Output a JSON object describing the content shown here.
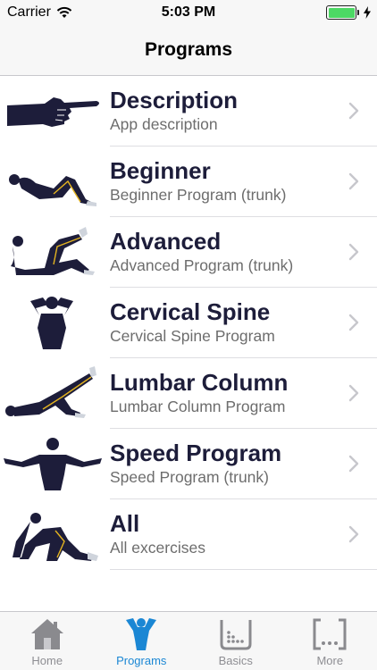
{
  "status_bar": {
    "carrier": "Carrier",
    "time": "5:03 PM",
    "battery_level": 1.0,
    "battery_color": "#4cd964"
  },
  "nav": {
    "title": "Programs"
  },
  "programs": [
    {
      "title": "Description",
      "subtitle": "App description",
      "icon": "pointing-hand-icon"
    },
    {
      "title": "Beginner",
      "subtitle": "Beginner Program (trunk)",
      "icon": "lying-figure-icon"
    },
    {
      "title": "Advanced",
      "subtitle": "Advanced Program (trunk)",
      "icon": "crunch-figure-icon"
    },
    {
      "title": "Cervical Spine",
      "subtitle": "Cervical Spine Program",
      "icon": "neck-figure-icon"
    },
    {
      "title": "Lumbar Column",
      "subtitle": "Lumbar Column Program",
      "icon": "leg-raise-figure-icon"
    },
    {
      "title": "Speed Program",
      "subtitle": "Speed Program (trunk)",
      "icon": "arms-out-figure-icon"
    },
    {
      "title": "All",
      "subtitle": "All excercises",
      "icon": "kneeling-figure-icon"
    }
  ],
  "tabs": [
    {
      "label": "Home",
      "icon": "home-icon",
      "active": false
    },
    {
      "label": "Programs",
      "icon": "person-icon",
      "active": true
    },
    {
      "label": "Basics",
      "icon": "dots-grid-icon",
      "active": false
    },
    {
      "label": "More",
      "icon": "more-icon",
      "active": false
    }
  ],
  "colors": {
    "accent": "#1b87d4",
    "figure": "#1d1d3a",
    "figure_line": "#e3b320"
  }
}
